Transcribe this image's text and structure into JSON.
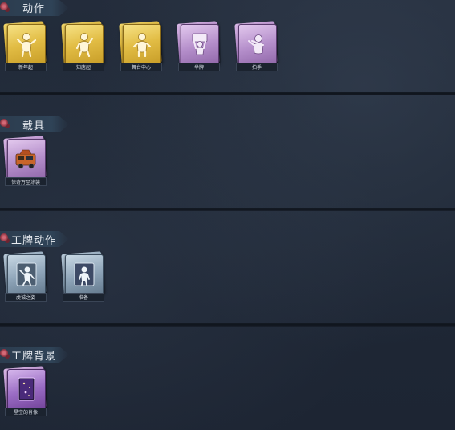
{
  "sections": [
    {
      "title": "动作",
      "items": [
        {
          "label": "新年起",
          "rarity": "gold",
          "icon": "dancing-figure-icon"
        },
        {
          "label": "知唐起",
          "rarity": "gold",
          "icon": "dancing-figure-icon"
        },
        {
          "label": "舞台中心",
          "rarity": "gold",
          "icon": "dancing-figure-icon"
        },
        {
          "label": "举牌",
          "rarity": "purple",
          "icon": "sign-holding-figure-icon"
        },
        {
          "label": "拍手",
          "rarity": "purple",
          "icon": "clapping-figure-icon"
        }
      ]
    },
    {
      "title": "载具",
      "items": [
        {
          "label": "惊奇万圣涂装",
          "rarity": "purple",
          "icon": "vehicle-icon"
        }
      ]
    },
    {
      "title": "工牌动作",
      "items": [
        {
          "label": "虔诚之姿",
          "rarity": "blue",
          "icon": "badge-figure-icon"
        },
        {
          "label": "准备",
          "rarity": "blue",
          "icon": "badge-figure-icon"
        }
      ]
    },
    {
      "title": "工牌背景",
      "items": [
        {
          "label": "星空的肖像",
          "rarity": "purple",
          "icon": "badge-background-icon"
        }
      ]
    }
  ],
  "colors": {
    "background": "#1f2735",
    "gold": "#d6ad32",
    "purple": "#a97cc0",
    "blue": "#7d93a8"
  }
}
